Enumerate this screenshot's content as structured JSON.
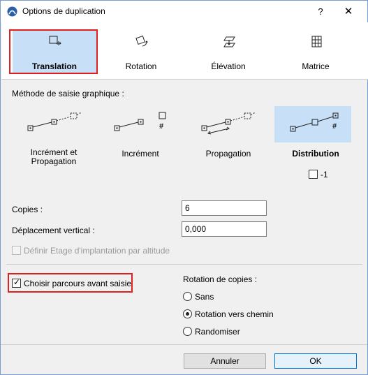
{
  "window": {
    "title": "Options de duplication",
    "help_label": "?",
    "close_label": "✕"
  },
  "tabs": [
    {
      "label": "Translation",
      "icon": "translation-icon",
      "selected": true
    },
    {
      "label": "Rotation",
      "icon": "rotation-icon",
      "selected": false
    },
    {
      "label": "Élévation",
      "icon": "elevation-icon",
      "selected": false
    },
    {
      "label": "Matrice",
      "icon": "matrix-icon",
      "selected": false
    }
  ],
  "method_section": {
    "label": "Méthode de saisie graphique :",
    "options": [
      {
        "label_line1": "Incrément et",
        "label_line2": "Propagation",
        "selected": false
      },
      {
        "label_line1": "Incrément",
        "label_line2": "",
        "selected": false
      },
      {
        "label_line1": "Propagation",
        "label_line2": "",
        "selected": false
      },
      {
        "label_line1": "Distribution",
        "label_line2": "",
        "selected": true
      }
    ],
    "hash_symbol": "#",
    "minus_one_label": "-1",
    "minus_one_checked": false
  },
  "fields": {
    "copies_label": "Copies :",
    "copies_value": "6",
    "vertical_label": "Déplacement vertical :",
    "vertical_value": "0,000",
    "floor_label": "Définir Etage d'implantation par altitude",
    "floor_checked": false
  },
  "path_choice": {
    "label": "Choisir parcours avant saisie",
    "checked": true,
    "checkmark": "✓"
  },
  "rotation_copies": {
    "label": "Rotation de copies :",
    "options": [
      {
        "label": "Sans",
        "selected": false
      },
      {
        "label": "Rotation vers chemin",
        "selected": true
      },
      {
        "label": "Randomiser",
        "selected": false
      }
    ]
  },
  "buttons": {
    "cancel": "Annuler",
    "ok": "OK"
  },
  "colors": {
    "selected_bg": "#c7e0f7",
    "highlight_red": "#e02020",
    "default_button_border": "#0078d7"
  }
}
